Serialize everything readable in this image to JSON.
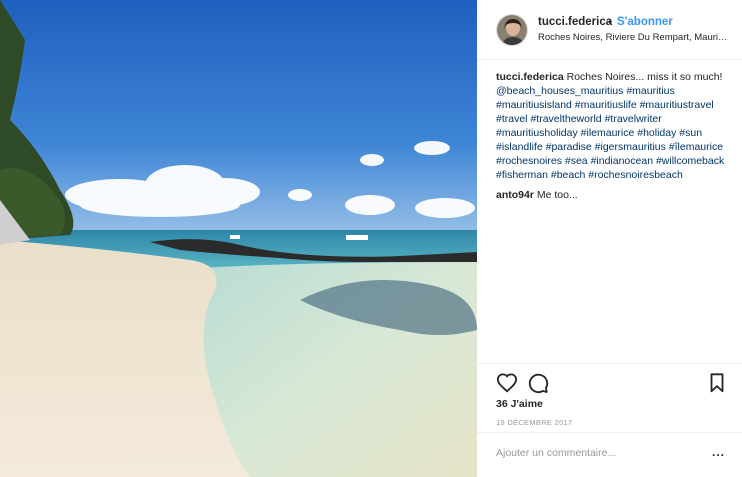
{
  "post": {
    "username": "tucci.federica",
    "separator": "•",
    "follow_label": "S'abonner",
    "location": "Roches Noires, Riviere Du Rempart, Mauritius",
    "caption_user": "tucci.federica",
    "caption_text": "Roches Noires... miss it so much! @beach_houses_mauritius #mauritius #mauritiusisland #mauritiuslife #mauritiustravel #travel #traveltheworld #travelwriter #mauritiusholiday #ilemaurice #holiday #sun #islandlife #paradise #igersmauritius #îlemaurice #rochesnoires #sea #indianocean #willcomeback #fisherman #beach #rochesnoiresbeach",
    "comment_user": "anto94r",
    "comment_text": "Me too...",
    "likes": "36 J'aime",
    "date": "19 DÉCEMBRE 2017",
    "add_comment_placeholder": "Ajouter un commentaire...",
    "more_label": "..."
  },
  "icons": {
    "like": "heart-icon",
    "comment": "comment-bubble-icon",
    "save": "bookmark-icon",
    "more": "more-options-icon"
  },
  "colors": {
    "link_blue": "#3897f0",
    "hashtag": "#003569",
    "text": "#262626",
    "muted": "#999999",
    "divider": "#efefef"
  }
}
